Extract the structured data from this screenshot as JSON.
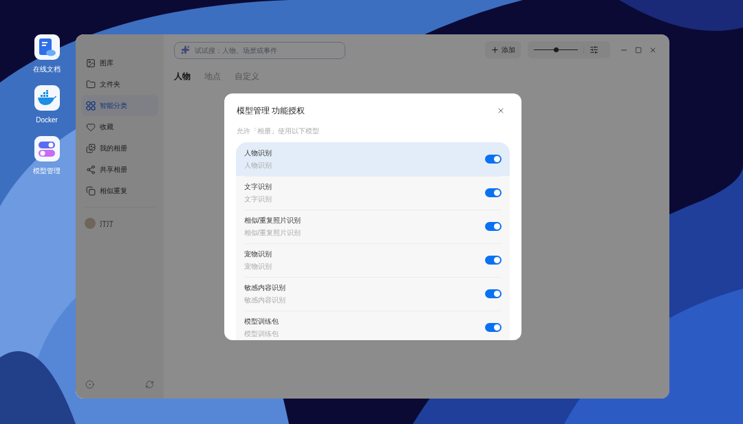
{
  "desktop": {
    "icons": [
      {
        "label": "在线文档",
        "kind": "doc"
      },
      {
        "label": "Docker",
        "kind": "docker"
      },
      {
        "label": "模型管理",
        "kind": "toggles"
      }
    ]
  },
  "sidebar": {
    "items": [
      {
        "label": "图库",
        "kind": "gallery",
        "selected": false
      },
      {
        "label": "文件夹",
        "kind": "folder",
        "selected": false
      },
      {
        "label": "智能分类",
        "kind": "grid",
        "selected": true
      },
      {
        "label": "收藏",
        "kind": "heart",
        "selected": false
      },
      {
        "label": "我的相册",
        "kind": "album",
        "selected": false
      },
      {
        "label": "共享相册",
        "kind": "share",
        "selected": false
      },
      {
        "label": "相似重复",
        "kind": "duplicate",
        "selected": false
      }
    ],
    "user": {
      "name": "汀汀"
    }
  },
  "toolbar": {
    "search": {
      "placeholder": "试试搜：人物、场景或事件"
    },
    "add_button": "添加",
    "zoom_slider": {
      "level": 0.5
    }
  },
  "tabs": [
    {
      "label": "人物",
      "selected": true
    },
    {
      "label": "地点",
      "selected": false
    },
    {
      "label": "自定义",
      "selected": false
    }
  ],
  "dialog": {
    "title": "模型管理 功能授权",
    "subtitle": "允许「相册」使用以下模型",
    "models": [
      {
        "name": "人物识别",
        "description": "人物识别",
        "on": true,
        "selected": true
      },
      {
        "name": "文字识别",
        "description": "文字识别",
        "on": true,
        "selected": false
      },
      {
        "name": "相似/重复照片识别",
        "description": "相似/重复照片识别",
        "on": true,
        "selected": false
      },
      {
        "name": "宠物识别",
        "description": "宠物识别",
        "on": true,
        "selected": false
      },
      {
        "name": "敏感内容识别",
        "description": "敏感内容识别",
        "on": true,
        "selected": false
      },
      {
        "name": "模型训练包",
        "description": "模型训练包",
        "on": true,
        "selected": false
      }
    ]
  }
}
